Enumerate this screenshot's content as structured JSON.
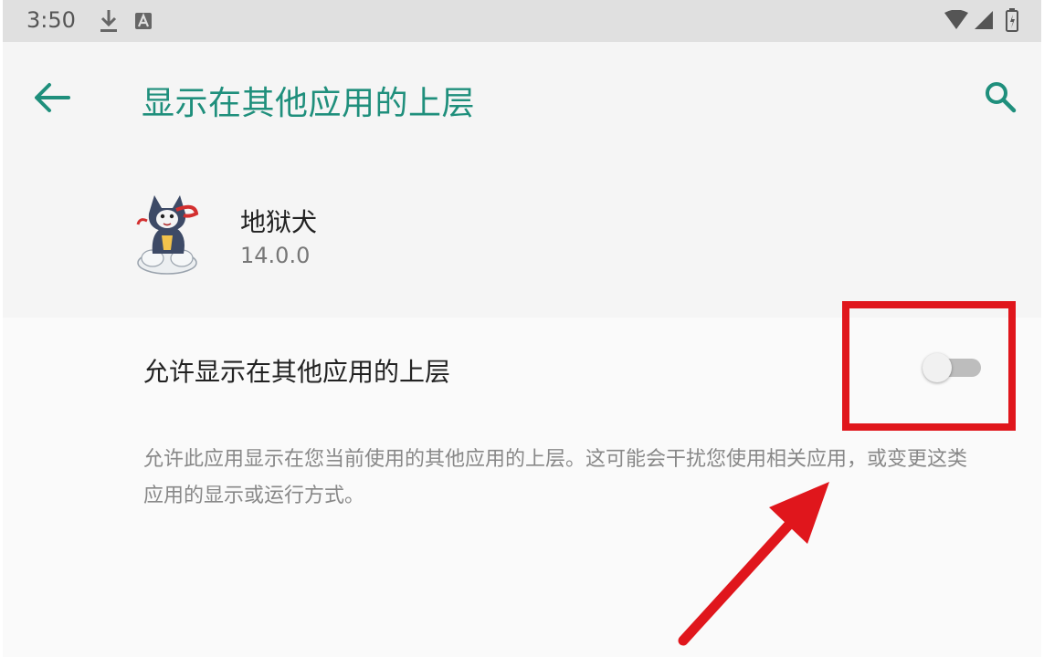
{
  "status_bar": {
    "time": "3:50",
    "icons": [
      "download-icon",
      "a-notification-icon",
      "wifi-icon",
      "signal-icon",
      "battery-icon"
    ]
  },
  "app_bar": {
    "title": "显示在其他应用的上层",
    "icons": [
      "back-arrow-icon",
      "search-icon"
    ]
  },
  "app_header": {
    "name": "地狱犬",
    "version": "14.0.0"
  },
  "permission": {
    "label": "允许显示在其他应用的上层",
    "enabled": false,
    "description": "允许此应用显示在您当前使用的其他应用的上层。这可能会干扰您使用相关应用，或变更这类应用的显示或运行方式。"
  },
  "colors": {
    "accent": "#1f8f7c",
    "annotation": "#e0161c",
    "toggle_off_track": "#bdbdbd"
  }
}
